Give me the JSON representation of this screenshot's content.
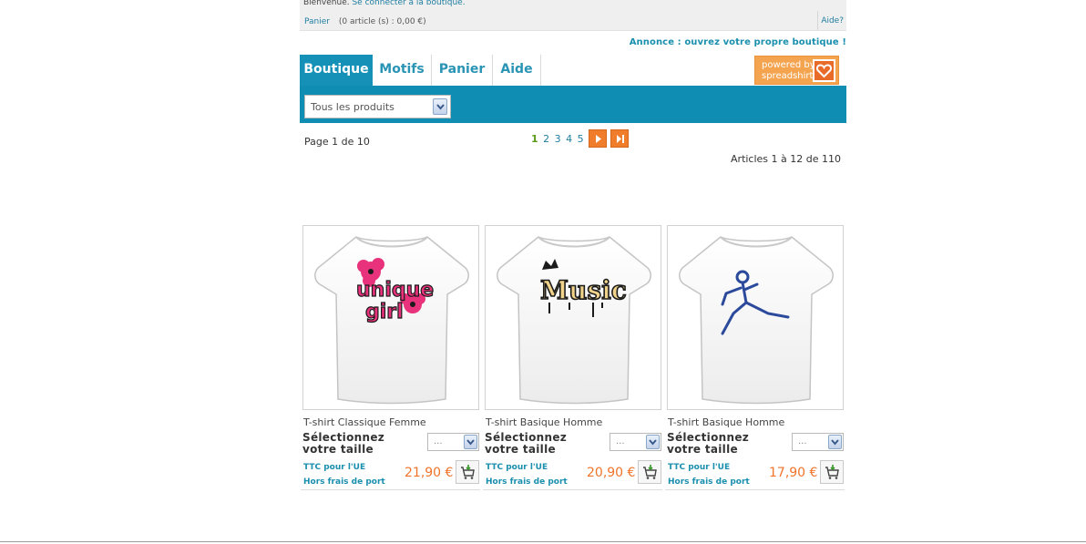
{
  "header": {
    "welcome_text": "Bienvenue.",
    "login_link": "Se connecter à la boutique.",
    "cart_link": "Panier",
    "cart_summary": "(0 article (s) : 0,00 €)",
    "help_link": "Aide?",
    "announcement": "Annonce : ouvrez votre propre boutique !"
  },
  "tabs": [
    {
      "label": "Boutique",
      "active": true
    },
    {
      "label": "Motifs",
      "active": false
    },
    {
      "label": "Panier",
      "active": false
    },
    {
      "label": "Aide",
      "active": false
    }
  ],
  "powered_by": {
    "text": "powered by\nspreadshirt",
    "icon": "spreadshirt-heart-icon"
  },
  "filter": {
    "selected": "Tous les produits"
  },
  "pagination": {
    "page_info": "Page 1 de 10",
    "pages": [
      "1",
      "2",
      "3",
      "4",
      "5"
    ],
    "current": "1",
    "articles_info": "Articles 1 à 12 de 110"
  },
  "products": [
    {
      "name": "T-shirt Classique Femme",
      "design_text": "unique girl",
      "size_label": "Sélectionnez votre taille",
      "size_value": "...",
      "ttc": "TTC pour l'UE",
      "shipping": "Hors frais de port",
      "price": "21,90 €",
      "design_colors": [
        "#e8327c",
        "#1b1b1b"
      ]
    },
    {
      "name": "T-shirt Basique Homme",
      "design_text": "Music",
      "size_label": "Sélectionnez votre taille",
      "size_value": "...",
      "ttc": "TTC pour l'UE",
      "shipping": "Hors frais de port",
      "price": "20,90 €",
      "design_colors": [
        "#f0d28a",
        "#1b1b1b"
      ]
    },
    {
      "name": "T-shirt Basique Homme",
      "design_text": "",
      "size_label": "Sélectionnez votre taille",
      "size_value": "...",
      "ttc": "TTC pour l'UE",
      "shipping": "Hors frais de port",
      "price": "17,90 €",
      "design_colors": [
        "#2c4a9c"
      ]
    }
  ],
  "colors": {
    "accent": "#0f8db3",
    "price": "#f0742c",
    "powered": "#f4a34f"
  }
}
